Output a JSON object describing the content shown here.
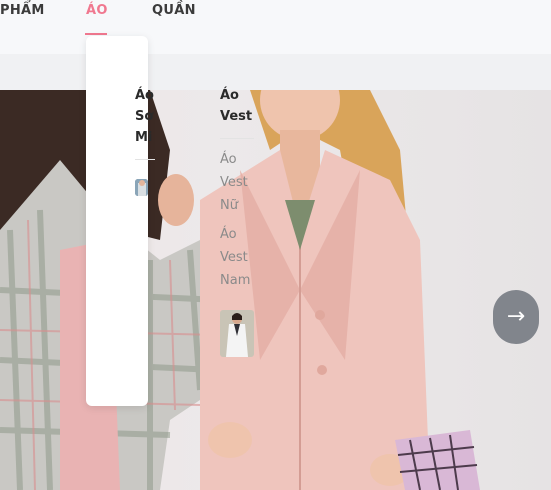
{
  "nav": {
    "items": [
      {
        "label": "PHẨM",
        "active": false
      },
      {
        "label": "ÁO",
        "active": true
      },
      {
        "label": "QUẦN",
        "active": false
      }
    ],
    "active_color": "#f0788f"
  },
  "mega_menu": {
    "columns": [
      {
        "title": "Áo Sơ Mi",
        "links": []
      },
      {
        "title": "Áo Vest",
        "links": [
          "Áo Vest Nữ",
          "Áo Vest Nam"
        ]
      }
    ]
  },
  "slider": {
    "next_icon": "arrow-right-icon",
    "next_glyph": "→"
  }
}
